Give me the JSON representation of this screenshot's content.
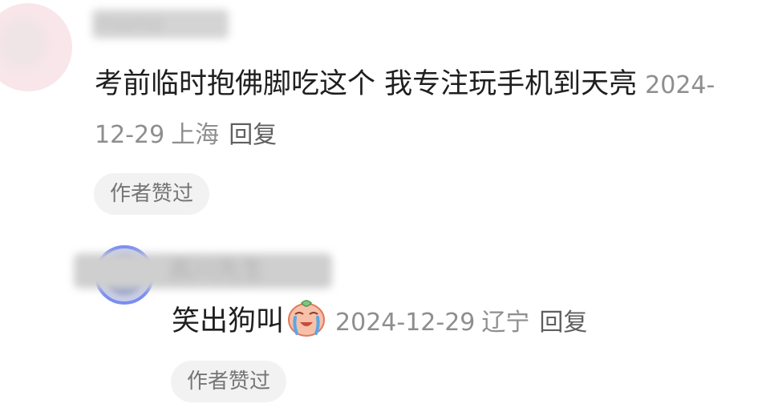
{
  "comments": [
    {
      "username": "momo",
      "text": "考前临时抱佛脚吃这个 我专注玩手机到天亮",
      "date": "2024-12-29",
      "location": "上海",
      "reply_label": "回复",
      "author_like_badge": "作者赞过"
    },
    {
      "username": "高川先生",
      "text": "笑出狗叫",
      "emoji": "crying-laughing-sticker",
      "date": "2024-12-29",
      "location": "辽宁",
      "reply_label": "回复",
      "author_like_badge": "作者赞过"
    }
  ],
  "colors": {
    "text_primary": "#1f1f1f",
    "text_meta": "#8e8e8e",
    "badge_bg": "#f2f2f2",
    "avatar_ring": "#7a8df2"
  }
}
